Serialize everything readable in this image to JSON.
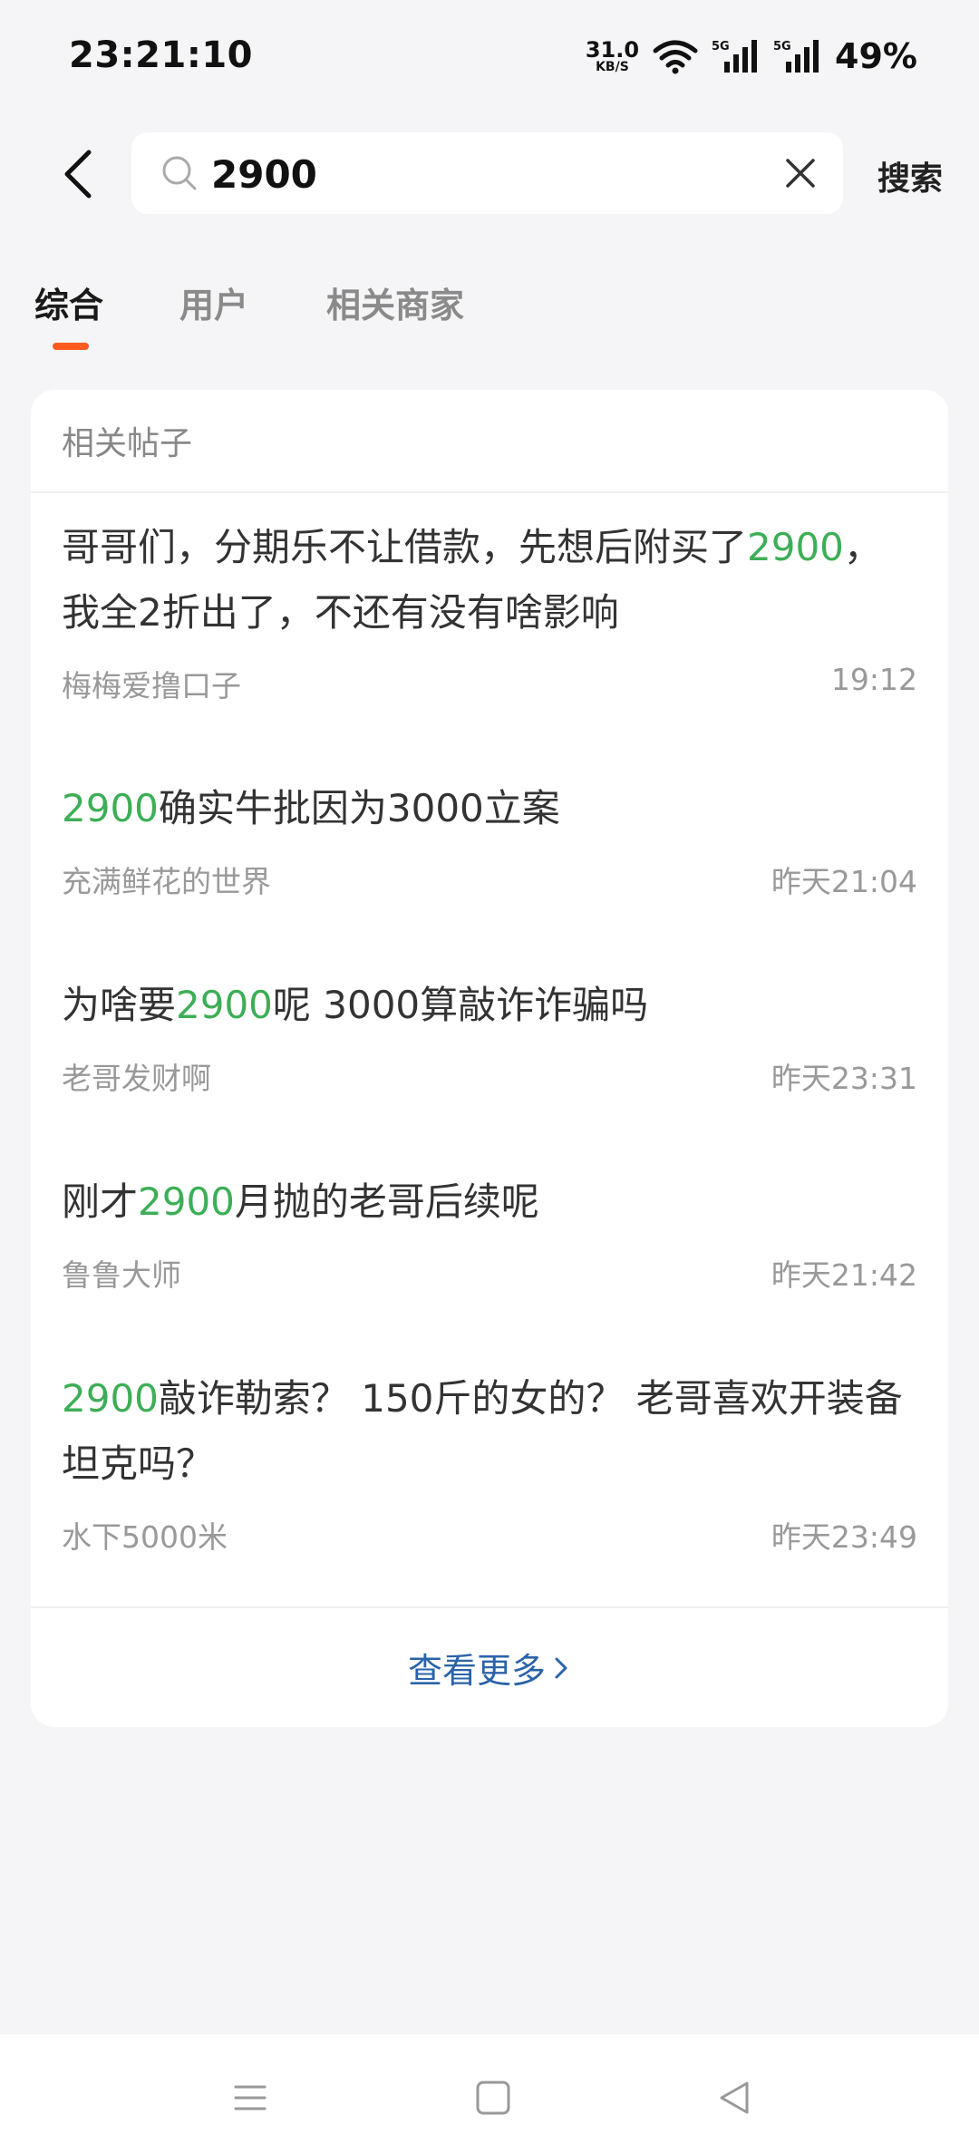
{
  "status_bar": {
    "time": "23:21:10",
    "net_speed_value": "31.0",
    "net_speed_unit": "KB/S",
    "battery": "49%",
    "icons": [
      "wifi-icon",
      "signal-5g-icon",
      "signal-5g-icon"
    ]
  },
  "search": {
    "query": "2900",
    "button_label": "搜索"
  },
  "tabs": [
    {
      "label": "综合",
      "active": true
    },
    {
      "label": "用户",
      "active": false
    },
    {
      "label": "相关商家",
      "active": false
    }
  ],
  "section": {
    "title": "相关帖子",
    "posts": [
      {
        "title_parts": [
          {
            "text": "哥哥们，分期乐不让借款，先想后附买了",
            "hl": false
          },
          {
            "text": "2900",
            "hl": true
          },
          {
            "text": "，我全2折出了，不还有没有啥影响",
            "hl": false
          }
        ],
        "author": "梅梅爱撸口子",
        "time": "19:12"
      },
      {
        "title_parts": [
          {
            "text": "2900",
            "hl": true
          },
          {
            "text": "确实牛批因为3000立案",
            "hl": false
          }
        ],
        "author": "充满鲜花的世界",
        "time": "昨天21:04"
      },
      {
        "title_parts": [
          {
            "text": "为啥要",
            "hl": false
          },
          {
            "text": "2900",
            "hl": true
          },
          {
            "text": "呢 3000算敲诈诈骗吗",
            "hl": false
          }
        ],
        "author": "老哥发财啊",
        "time": "昨天23:31"
      },
      {
        "title_parts": [
          {
            "text": "刚才",
            "hl": false
          },
          {
            "text": "2900",
            "hl": true
          },
          {
            "text": "月抛的老哥后续呢",
            "hl": false
          }
        ],
        "author": "鲁鲁大师",
        "time": "昨天21:42"
      },
      {
        "title_parts": [
          {
            "text": "2900",
            "hl": true
          },
          {
            "text": "敲诈勒索？ 150斤的女的？ 老哥喜欢开装备坦克吗？",
            "hl": false
          }
        ],
        "author": "水下5000米",
        "time": "昨天23:49"
      }
    ],
    "more_label": "查看更多"
  },
  "colors": {
    "highlight": "#3dae56",
    "accent": "#ff5a1f",
    "link": "#2b63a8"
  }
}
